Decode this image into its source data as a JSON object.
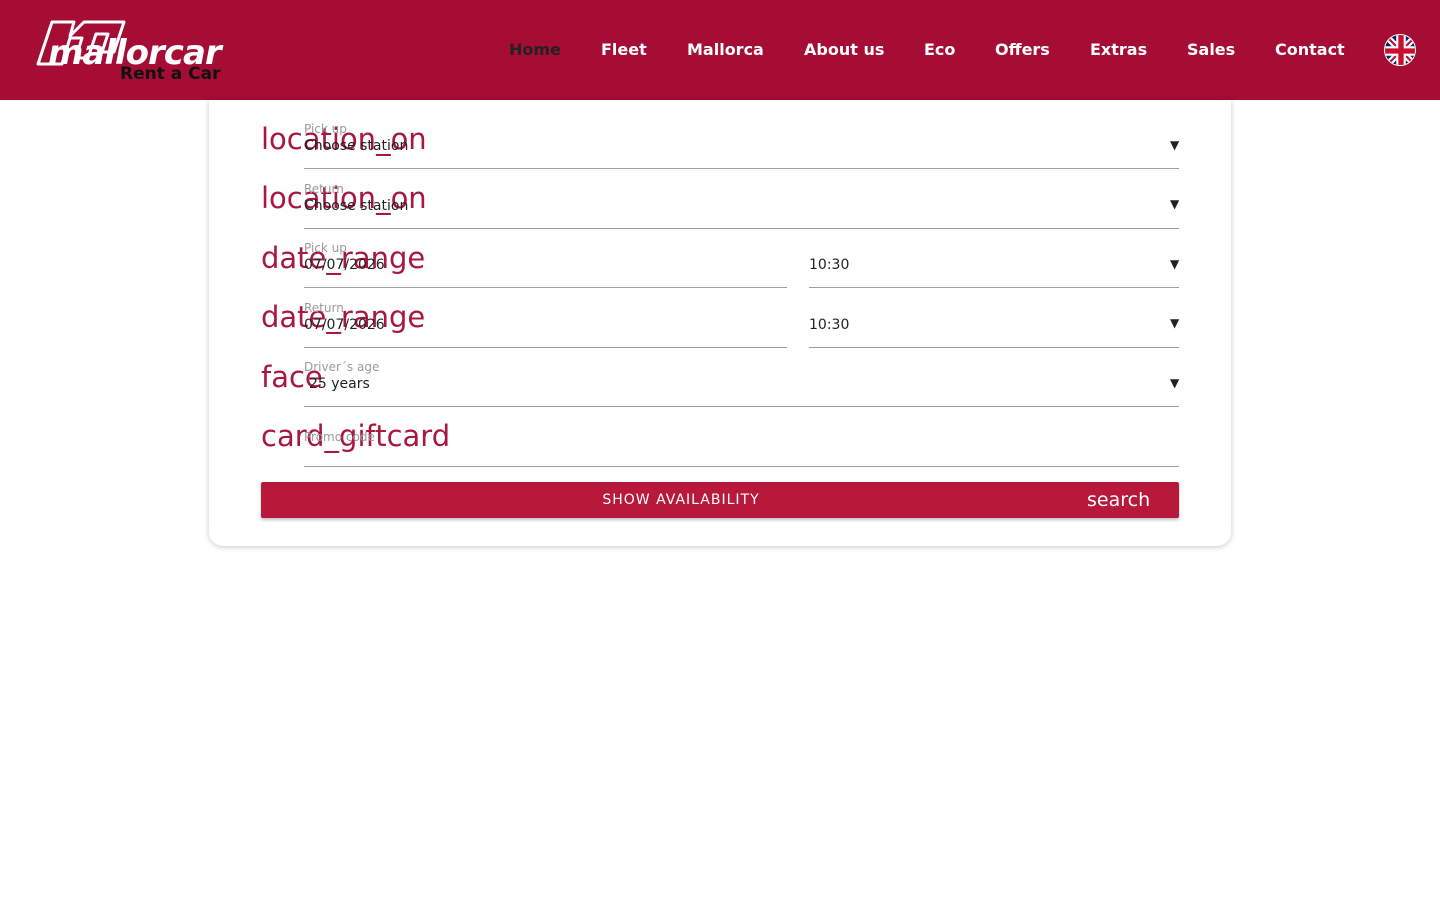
{
  "brand": {
    "name": "mallorcar",
    "tagline": "Rent a Car"
  },
  "nav": {
    "items": [
      "Home",
      "Fleet",
      "Mallorca",
      "About us",
      "Eco",
      "Offers",
      "Extras",
      "Sales",
      "Contact"
    ],
    "active": "Home",
    "language_icon": "uk-flag-icon"
  },
  "form": {
    "pickup_station": {
      "icon": "location_on",
      "label": "Pick up",
      "value": "Choose station"
    },
    "return_station": {
      "icon": "location_on",
      "label": "Return",
      "value": "Choose station"
    },
    "pickup_date": {
      "icon": "date_range",
      "label": "Pick up",
      "date": "07/07/2026",
      "time": "10:30"
    },
    "return_date": {
      "icon": "date_range",
      "label": "Return",
      "date": "07/07/2026",
      "time": "10:30"
    },
    "driver_age": {
      "icon": "face",
      "label": "Driver´s age",
      "value": "25 years"
    },
    "promo": {
      "icon": "card_giftcard",
      "placeholder": "Promo code"
    },
    "submit": {
      "label": "SHOW AVAILABILITY",
      "icon": "search"
    }
  },
  "colors": {
    "header_bg": "#a50d35",
    "accent": "#a8183e",
    "button_bg": "#b8183a"
  }
}
